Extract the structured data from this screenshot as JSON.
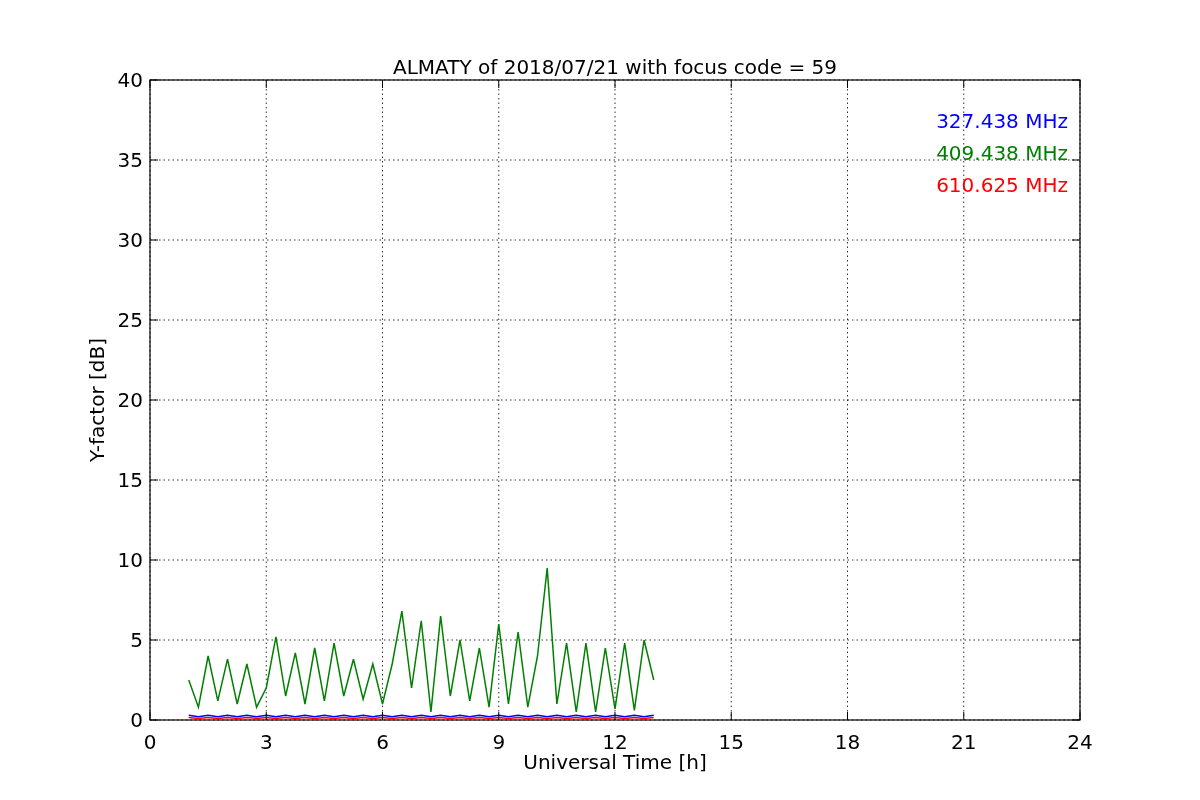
{
  "chart_data": {
    "type": "line",
    "title": "ALMATY of 2018/07/21 with focus code = 59",
    "xlabel": "Universal Time [h]",
    "ylabel": "Y-factor [dB]",
    "x": [
      1,
      1.25,
      1.5,
      1.75,
      2,
      2.25,
      2.5,
      2.75,
      3,
      3.25,
      3.5,
      3.75,
      4,
      4.25,
      4.5,
      4.75,
      5,
      5.25,
      5.5,
      5.75,
      6,
      6.25,
      6.5,
      6.75,
      7,
      7.25,
      7.5,
      7.75,
      8,
      8.25,
      8.5,
      8.75,
      9,
      9.25,
      9.5,
      9.75,
      10,
      10.25,
      10.5,
      10.75,
      11,
      11.25,
      11.5,
      11.75,
      12,
      12.25,
      12.5,
      12.75,
      13
    ],
    "series": [
      {
        "name": "327.438 MHz",
        "color": "#0000ff",
        "values": [
          0.3,
          0.2,
          0.3,
          0.2,
          0.3,
          0.2,
          0.3,
          0.2,
          0.3,
          0.2,
          0.3,
          0.2,
          0.3,
          0.2,
          0.3,
          0.2,
          0.3,
          0.2,
          0.3,
          0.2,
          0.3,
          0.2,
          0.3,
          0.2,
          0.3,
          0.2,
          0.3,
          0.2,
          0.3,
          0.2,
          0.3,
          0.2,
          0.3,
          0.2,
          0.3,
          0.2,
          0.3,
          0.2,
          0.3,
          0.2,
          0.3,
          0.2,
          0.3,
          0.2,
          0.3,
          0.2,
          0.3,
          0.2,
          0.3
        ]
      },
      {
        "name": "409.438 MHz",
        "color": "#008000",
        "values": [
          2.5,
          0.8,
          4,
          1.2,
          3.8,
          1,
          3.5,
          0.8,
          2,
          5.2,
          1.5,
          4.2,
          1,
          4.5,
          1.2,
          4.8,
          1.5,
          3.8,
          1.3,
          3.5,
          1,
          3.5,
          6.8,
          2,
          6.2,
          0.5,
          6.5,
          1.5,
          5,
          1.2,
          4.5,
          0.8,
          6,
          1,
          5.5,
          0.8,
          4,
          9.5,
          1,
          4.8,
          0.5,
          4.8,
          0.5,
          4.5,
          0.7,
          4.8,
          0.6,
          5,
          2.5
        ]
      },
      {
        "name": "610.625 MHz",
        "color": "#ff0000",
        "values": [
          0.15,
          0.1,
          0.15,
          0.1,
          0.15,
          0.1,
          0.15,
          0.1,
          0.15,
          0.1,
          0.15,
          0.1,
          0.15,
          0.1,
          0.15,
          0.1,
          0.15,
          0.1,
          0.15,
          0.1,
          0.15,
          0.1,
          0.15,
          0.1,
          0.15,
          0.1,
          0.15,
          0.1,
          0.15,
          0.1,
          0.15,
          0.1,
          0.15,
          0.1,
          0.15,
          0.1,
          0.15,
          0.1,
          0.15,
          0.1,
          0.15,
          0.1,
          0.15,
          0.1,
          0.15,
          0.1,
          0.15,
          0.1,
          0.15
        ]
      }
    ],
    "grid": true,
    "xlim": [
      0,
      24
    ],
    "ylim": [
      0,
      40
    ],
    "xticks": [
      0,
      3,
      6,
      9,
      12,
      15,
      18,
      21,
      24
    ],
    "yticks": [
      0,
      5,
      10,
      15,
      20,
      25,
      30,
      35,
      40
    ]
  }
}
